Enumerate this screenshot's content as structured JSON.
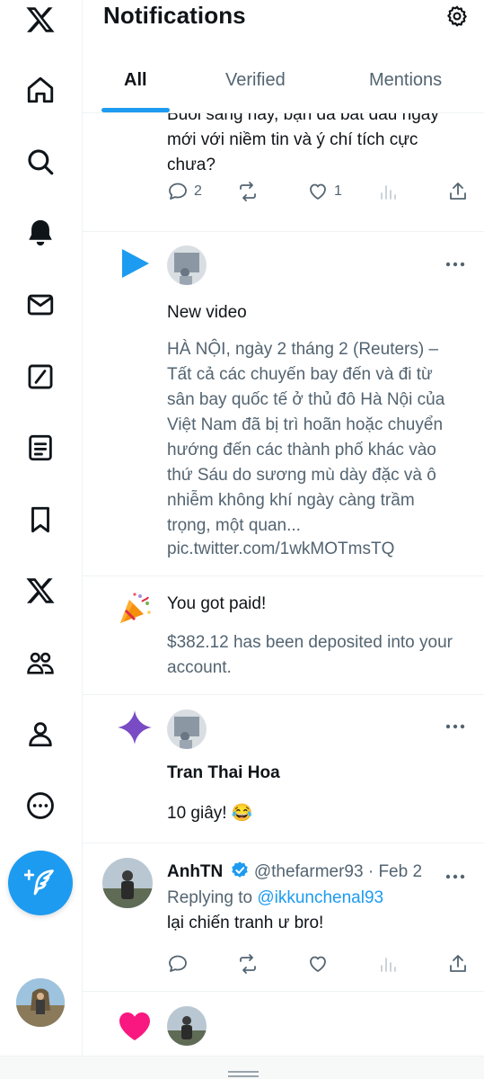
{
  "app": {
    "brand_color": "#1d9bf0"
  },
  "header": {
    "title": "Notifications",
    "tabs": [
      {
        "label": "All",
        "active": true
      },
      {
        "label": "Verified",
        "active": false
      },
      {
        "label": "Mentions",
        "active": false
      }
    ]
  },
  "sidebar": {
    "items": [
      {
        "name": "x-logo",
        "icon": "x-logo-icon"
      },
      {
        "name": "home",
        "icon": "home-icon"
      },
      {
        "name": "search",
        "icon": "search-icon"
      },
      {
        "name": "notifications",
        "icon": "bell-icon"
      },
      {
        "name": "messages",
        "icon": "mail-icon"
      },
      {
        "name": "grok",
        "icon": "grok-icon"
      },
      {
        "name": "lists",
        "icon": "list-icon"
      },
      {
        "name": "bookmarks",
        "icon": "bookmark-icon"
      },
      {
        "name": "premium",
        "icon": "x-icon"
      },
      {
        "name": "communities",
        "icon": "communities-icon"
      },
      {
        "name": "profile",
        "icon": "profile-icon"
      },
      {
        "name": "more",
        "icon": "more-circle-icon"
      }
    ]
  },
  "notifications": {
    "first": {
      "text": "Buổi sáng nay, bạn đã bắt đầu ngày mới với niềm tin và ý chí tích cực chưa?",
      "replies": "2",
      "likes": "1"
    },
    "video": {
      "heading": "New video",
      "body": "HÀ NỘI, ngày 2 tháng 2 (Reuters) – Tất cả các chuyến bay đến và đi từ sân bay quốc tế ở thủ đô Hà Nội của Việt Nam đã bị trì hoãn hoặc chuyển hướng đến các thành phố khác vào thứ Sáu do sương mù dày đặc và ô nhiễm không khí ngày càng trầm trọng, một quan...",
      "link": "pic.twitter.com/1wkMOTmsTQ"
    },
    "paid": {
      "heading": "You got paid!",
      "body": "$382.12 has been deposited into your account."
    },
    "spark": {
      "name": "Tran Thai Hoa",
      "text": "10 giây! 😂"
    },
    "reply": {
      "name": "AnhTN",
      "handle": "@thefarmer93",
      "date": "· Feb 2",
      "replying_label": "Replying to",
      "replying_to": "@ikkunchenal93",
      "text": "lại chiến tranh ư bro!"
    }
  }
}
